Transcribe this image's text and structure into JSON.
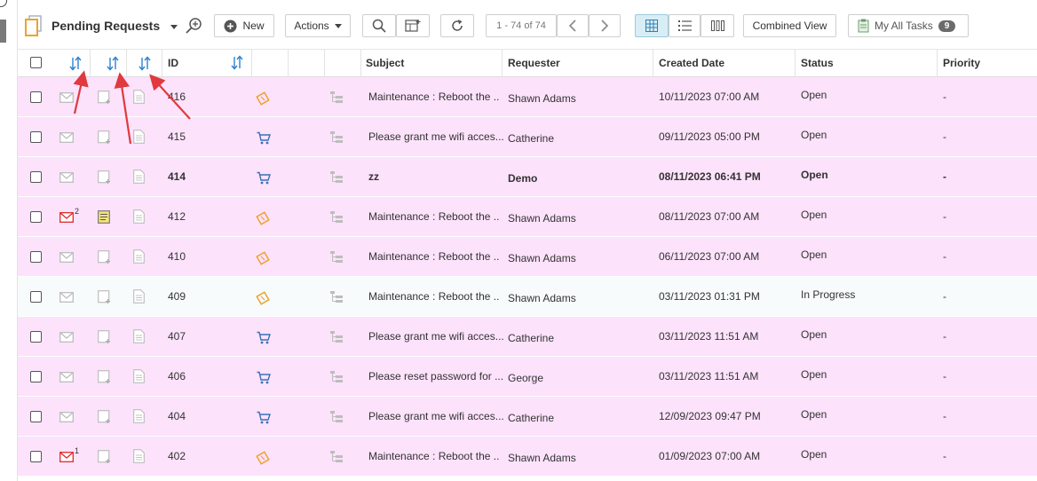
{
  "toolbar": {
    "view_name": "Pending Requests",
    "new_label": "New",
    "actions_label": "Actions",
    "pagination": "1 - 74 of 74",
    "combined_view": "Combined View",
    "my_tasks_label": "My All Tasks",
    "my_tasks_count": "9"
  },
  "columns": {
    "id": "ID",
    "subject": "Subject",
    "requester": "Requester",
    "created": "Created Date",
    "status": "Status",
    "priority": "Priority"
  },
  "rows": [
    {
      "id": "416",
      "subject": "Maintenance : Reboot the ..",
      "requester": "Shawn Adams",
      "created": "10/11/2023 07:00 AM",
      "status": "Open",
      "priority": "-",
      "type": "incident",
      "mail_count": "",
      "note": false,
      "bg": "pink",
      "bold": false
    },
    {
      "id": "415",
      "subject": "Please grant me wifi acces...",
      "requester": "Catherine",
      "created": "09/11/2023 05:00 PM",
      "status": "Open",
      "priority": "-",
      "type": "service",
      "mail_count": "",
      "note": false,
      "bg": "pink",
      "bold": false
    },
    {
      "id": "414",
      "subject": "zz",
      "requester": "Demo",
      "created": "08/11/2023 06:41 PM",
      "status": "Open",
      "priority": "-",
      "type": "service",
      "mail_count": "",
      "note": false,
      "bg": "pink",
      "bold": true
    },
    {
      "id": "412",
      "subject": "Maintenance : Reboot the ..",
      "requester": "Shawn Adams",
      "created": "08/11/2023 07:00 AM",
      "status": "Open",
      "priority": "-",
      "type": "incident",
      "mail_count": "2",
      "note": true,
      "bg": "pink",
      "bold": false
    },
    {
      "id": "410",
      "subject": "Maintenance : Reboot the ..",
      "requester": "Shawn Adams",
      "created": "06/11/2023 07:00 AM",
      "status": "Open",
      "priority": "-",
      "type": "incident",
      "mail_count": "",
      "note": false,
      "bg": "pink",
      "bold": false
    },
    {
      "id": "409",
      "subject": "Maintenance : Reboot the ..",
      "requester": "Shawn Adams",
      "created": "03/11/2023 01:31 PM",
      "status": "In Progress",
      "priority": "-",
      "type": "incident",
      "mail_count": "",
      "note": false,
      "bg": "white",
      "bold": false
    },
    {
      "id": "407",
      "subject": "Please grant me wifi acces...",
      "requester": "Catherine",
      "created": "03/11/2023 11:51 AM",
      "status": "Open",
      "priority": "-",
      "type": "service",
      "mail_count": "",
      "note": false,
      "bg": "pink",
      "bold": false
    },
    {
      "id": "406",
      "subject": "Please reset password for ...",
      "requester": "George",
      "created": "03/11/2023 11:51 AM",
      "status": "Open",
      "priority": "-",
      "type": "service",
      "mail_count": "",
      "note": false,
      "bg": "pink",
      "bold": false
    },
    {
      "id": "404",
      "subject": "Please grant me wifi acces...",
      "requester": "Catherine",
      "created": "12/09/2023 09:47 PM",
      "status": "Open",
      "priority": "-",
      "type": "service",
      "mail_count": "",
      "note": false,
      "bg": "pink",
      "bold": false
    },
    {
      "id": "402",
      "subject": "Maintenance : Reboot the ..",
      "requester": "Shawn Adams",
      "created": "01/09/2023 07:00 AM",
      "status": "Open",
      "priority": "-",
      "type": "incident",
      "mail_count": "1",
      "note": false,
      "bg": "pink",
      "bold": false
    }
  ],
  "colors": {
    "row_pink": "#fde2fc",
    "row_white": "#f7fbfc",
    "sort_blue": "#2f7fd0",
    "arrow_red": "#e0393e",
    "incident_orange": "#f0a02a",
    "service_blue": "#3b6fb5",
    "mail_red": "#e02a2a"
  }
}
